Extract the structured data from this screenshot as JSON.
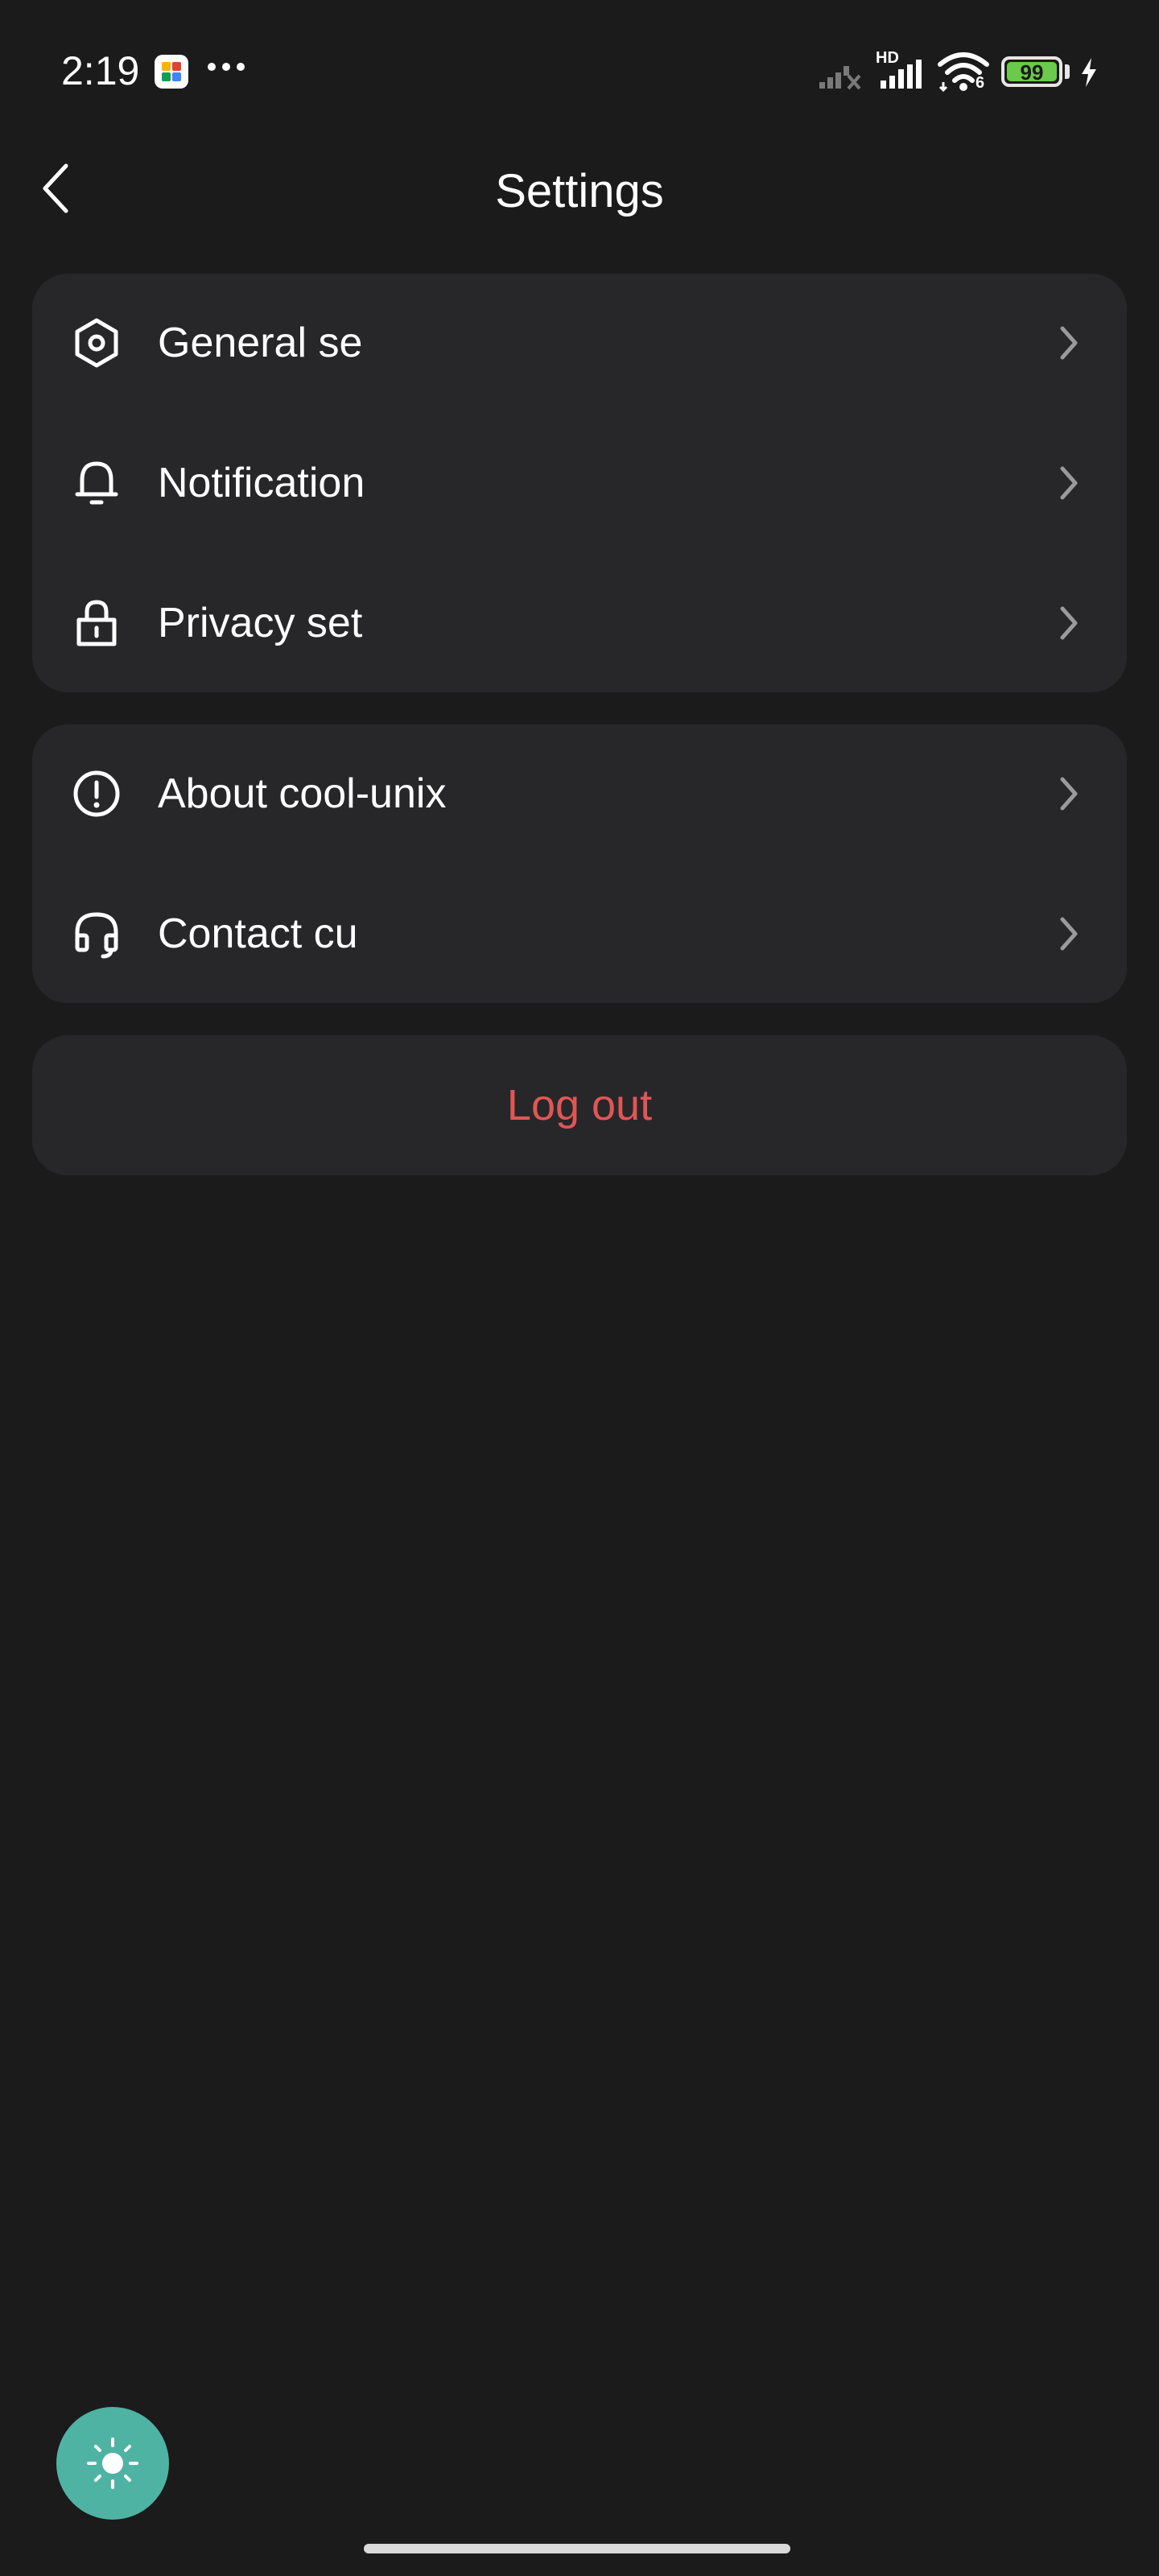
{
  "status_bar": {
    "time": "2:19",
    "network_badge": "HD",
    "wifi_badge": "6",
    "battery": "99",
    "icons": [
      "app-launcher-icon",
      "more-dots-icon",
      "signal-off-icon",
      "signal-icon",
      "wifi-icon",
      "battery-icon",
      "charging-icon"
    ]
  },
  "header": {
    "title": "Settings",
    "back_icon": "chevron-left-icon"
  },
  "settings_groups": [
    {
      "items": [
        {
          "label": "General se",
          "icon": "settings-hex-icon"
        },
        {
          "label": "Notification",
          "icon": "bell-icon"
        },
        {
          "label": "Privacy set",
          "icon": "lock-icon"
        }
      ]
    },
    {
      "items": [
        {
          "label": "About cool-unix",
          "icon": "info-alert-icon"
        },
        {
          "label": "Contact cu",
          "icon": "headset-icon"
        }
      ]
    }
  ],
  "logout": {
    "label": "Log out"
  },
  "colors": {
    "background": "#1b1b1b",
    "card": "#272729",
    "logout_text": "#e05656",
    "fab": "#4fb3a3",
    "battery_fill": "#6bc94b"
  },
  "fab": {
    "icon": "sun-icon"
  }
}
